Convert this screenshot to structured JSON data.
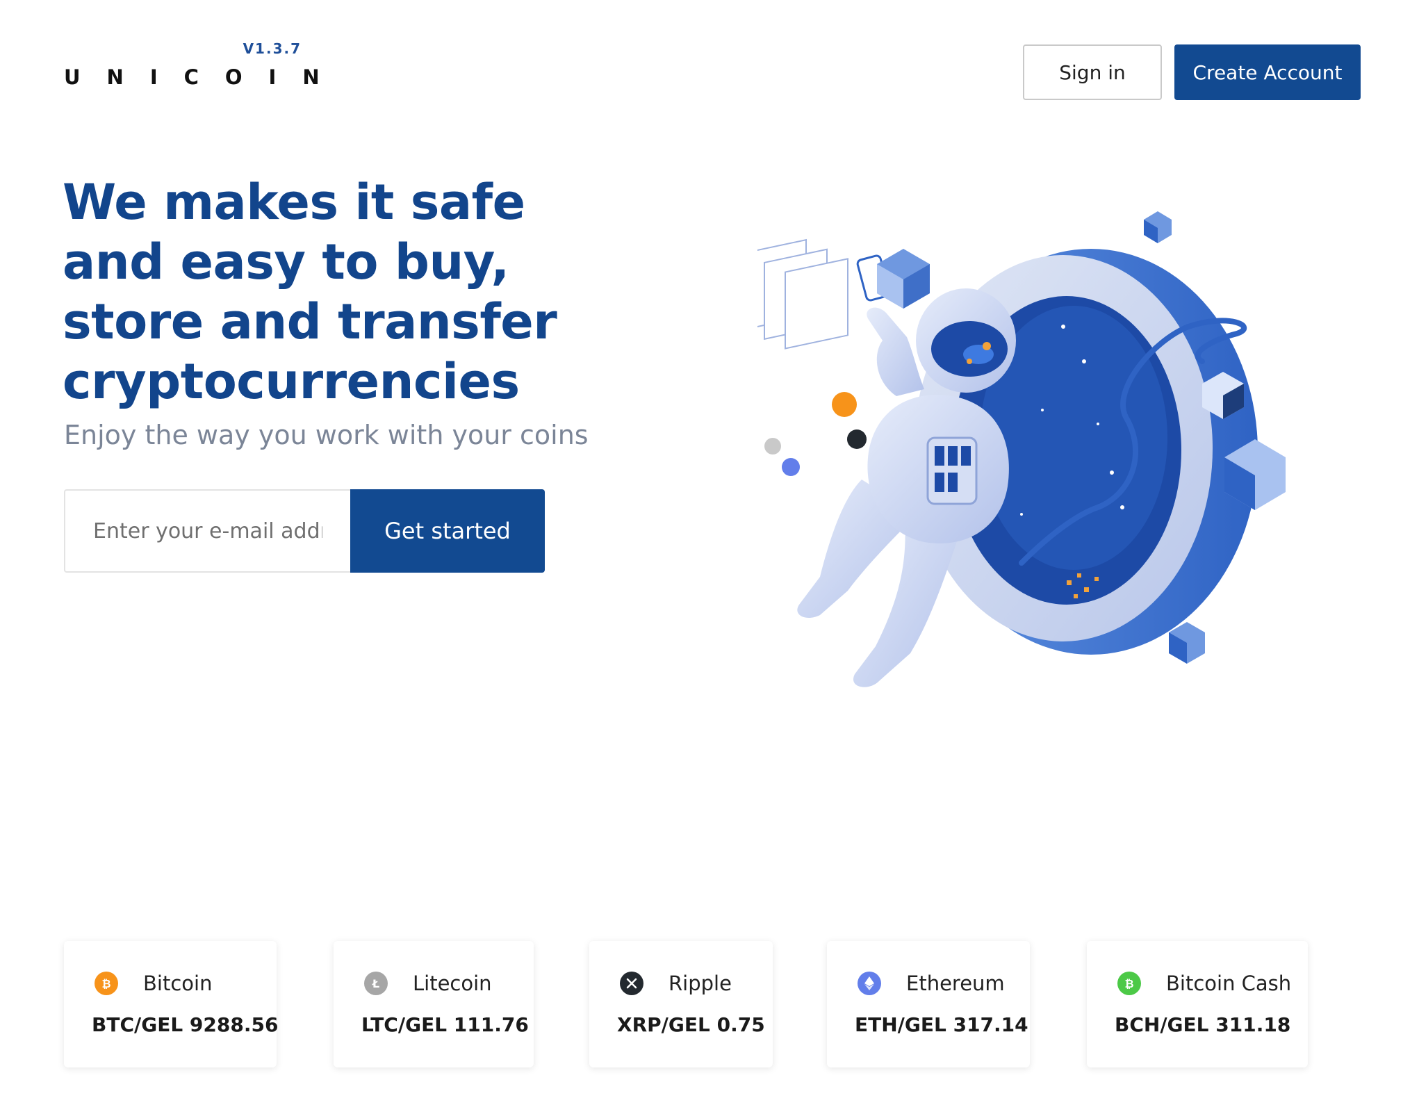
{
  "header": {
    "logo_version": "V1.3.7",
    "logo_text": "UNICOIN",
    "signin_label": "Sign in",
    "create_label": "Create Account"
  },
  "hero": {
    "title": "We makes it safe and easy to buy, store and transfer cryptocurrencies",
    "subtitle": "Enjoy the way you work with your coins",
    "email_placeholder": "Enter your e-mail address",
    "cta_label": "Get started"
  },
  "colors": {
    "brand": "#124a91",
    "bitcoin": "#f7931a",
    "litecoin": "#a6a6a6",
    "ripple": "#23292f",
    "ethereum": "#627eea",
    "bitcoin_cash": "#4cc947"
  },
  "tickers": [
    {
      "name": "Bitcoin",
      "pair": "BTC/GEL 9288.56",
      "icon": "bitcoin-icon"
    },
    {
      "name": "Litecoin",
      "pair": "LTC/GEL 111.76",
      "icon": "litecoin-icon"
    },
    {
      "name": "Ripple",
      "pair": "XRP/GEL 0.75",
      "icon": "ripple-icon"
    },
    {
      "name": "Ethereum",
      "pair": "ETH/GEL 317.14",
      "icon": "ethereum-icon"
    },
    {
      "name": "Bitcoin Cash",
      "pair": "BCH/GEL 311.18",
      "icon": "bitcoin-cash-icon"
    }
  ]
}
